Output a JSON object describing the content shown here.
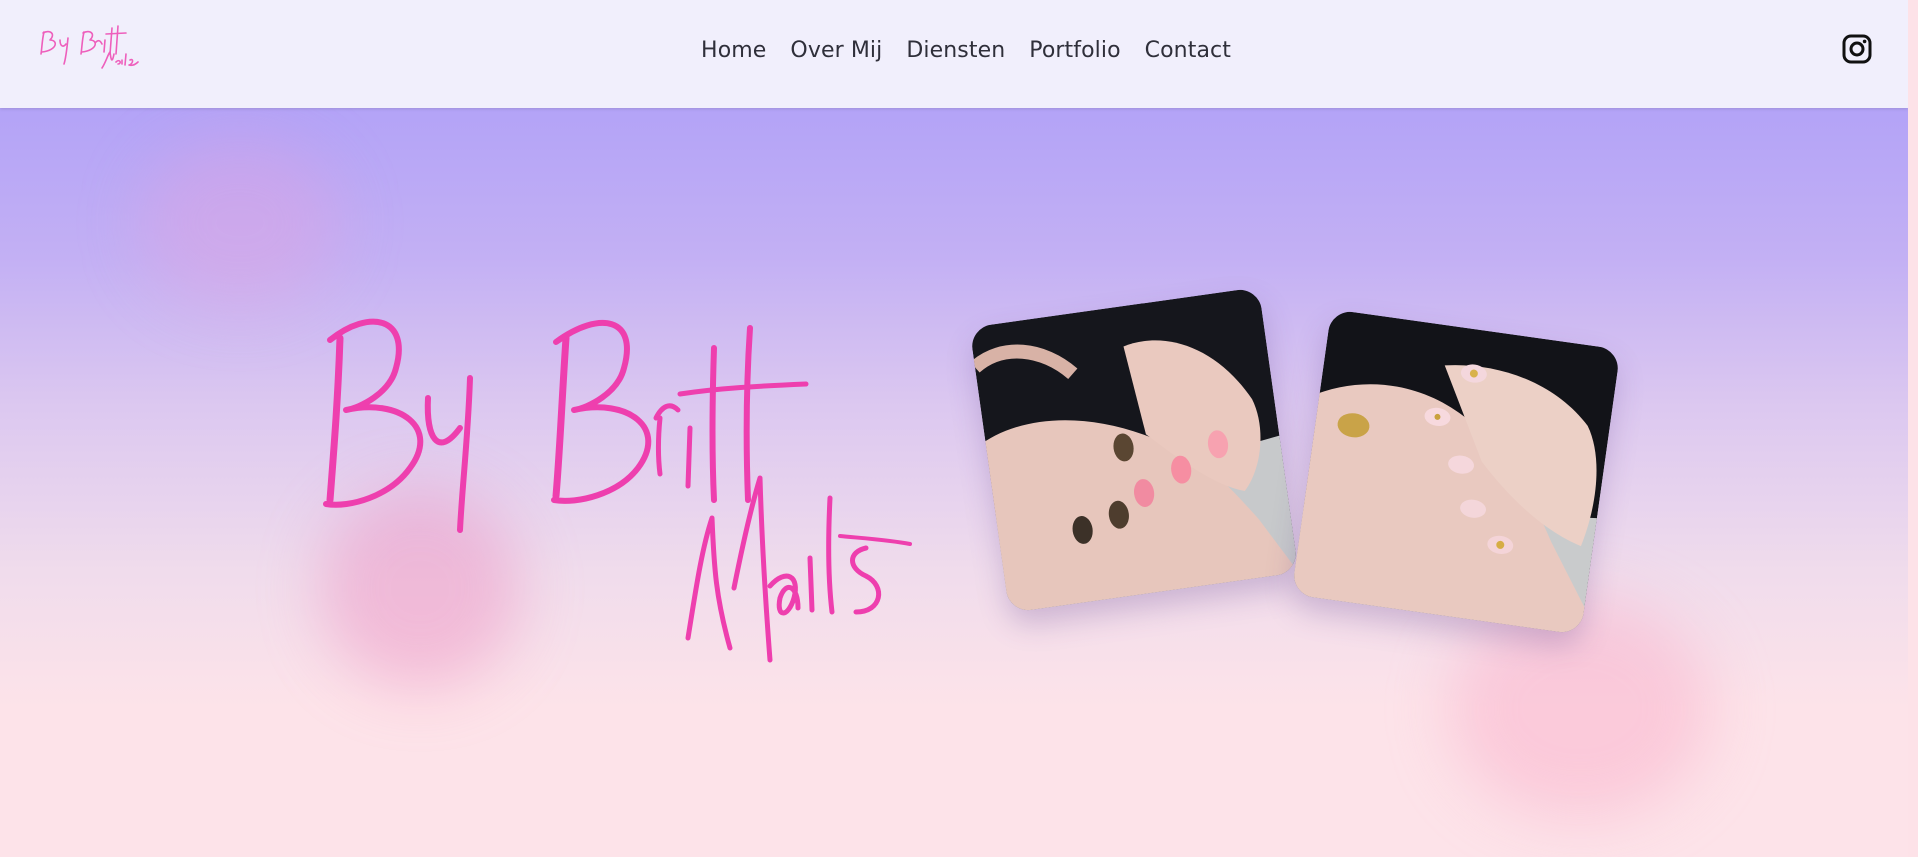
{
  "header": {
    "logo_text": "By Britt Nails",
    "nav": {
      "home": "Home",
      "over_mij": "Over Mij",
      "diensten": "Diensten",
      "portfolio": "Portfolio",
      "contact": "Contact"
    },
    "social_icon": "instagram-icon"
  },
  "hero": {
    "script_title": "By Britt Nails",
    "photos": [
      "nails-photo-black-gold-pink",
      "nails-photo-pink-gold-stars"
    ]
  },
  "colors": {
    "header_bg": "#f1effc",
    "hero_top": "#b3a3f7",
    "hero_bottom": "#fde3e9",
    "script_pink": "#ee3fae",
    "nav_text": "#2f2f3a"
  }
}
